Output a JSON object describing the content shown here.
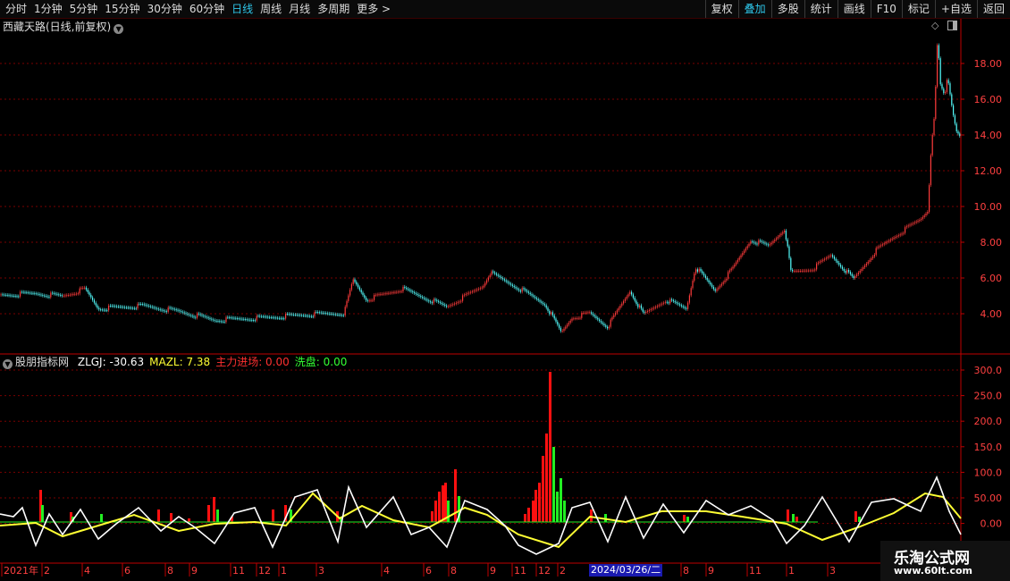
{
  "toolbar": {
    "left": [
      "分时",
      "1分钟",
      "5分钟",
      "15分钟",
      "30分钟",
      "60分钟",
      "日线",
      "周线",
      "月线",
      "多周期",
      "更多 >"
    ],
    "active": "日线",
    "right": [
      "复权",
      "叠加",
      "多股",
      "统计",
      "画线",
      "F10",
      "标记",
      "+自选",
      "返回"
    ]
  },
  "main": {
    "title": "西藏天路(日线,前复权)",
    "y_labels": [
      "18.00",
      "16.00",
      "14.00",
      "12.00",
      "10.00",
      "8.00",
      "6.00",
      "4.00"
    ]
  },
  "indicator": {
    "name": "股朋指标网",
    "items": [
      {
        "label": "ZLGJ:",
        "value": "-30.63",
        "color": "#ffffff"
      },
      {
        "label": "MAZL:",
        "value": "7.38",
        "color": "#ffff33"
      },
      {
        "label": "主力进场:",
        "value": "0.00",
        "color": "#ff3030"
      },
      {
        "label": "洗盘:",
        "value": "0.00",
        "color": "#33ff33"
      }
    ],
    "y_labels": [
      "300.0",
      "250.0",
      "200.0",
      "150.0",
      "100.0",
      "50.00",
      "0.00"
    ]
  },
  "time_axis": {
    "labels": [
      "2021年",
      "2",
      "4",
      "6",
      "8",
      "9",
      "11",
      "12",
      "1",
      "3",
      "4",
      "6",
      "8",
      "9",
      "11",
      "12",
      "2",
      "8",
      "9",
      "11",
      "1",
      "3"
    ],
    "cursor_date": "2024/03/26/二"
  },
  "watermark": {
    "line1": "乐淘公式网",
    "line2": "www.60lt.com"
  },
  "colors": {
    "up": "#ff3b3b",
    "down": "#54ffff",
    "grid": "#7a0000",
    "axis": "#c00000",
    "ma": "#ffff33",
    "osc": "#ffffff",
    "entry": "#ff1010",
    "wash": "#22ee22"
  }
}
